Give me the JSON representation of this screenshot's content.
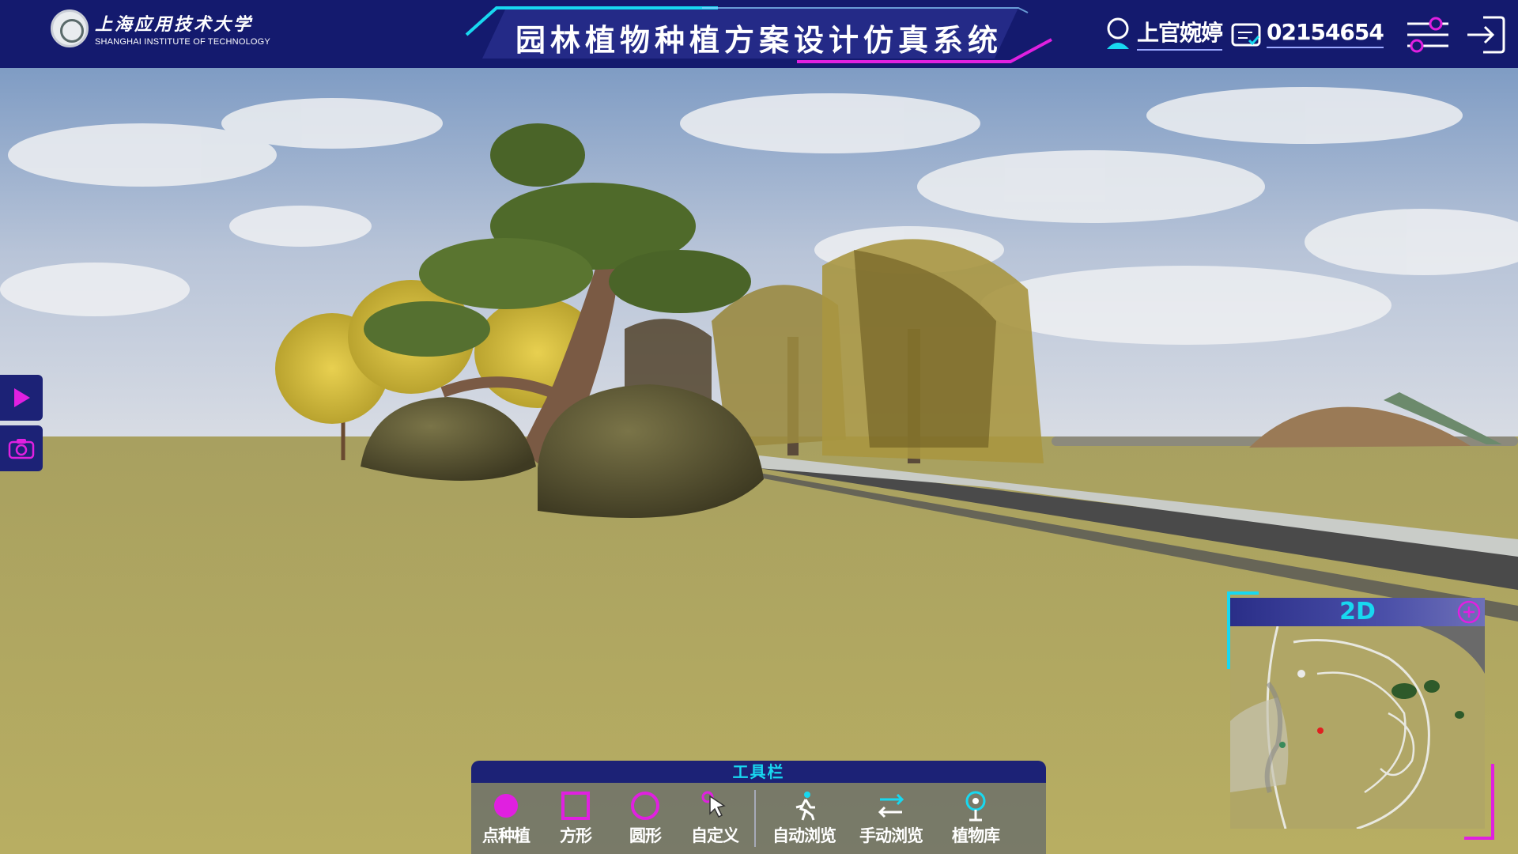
{
  "header": {
    "school_name_cn": "上海应用技术大学",
    "school_name_en": "SHANGHAI INSTITUTE OF TECHNOLOGY",
    "title": "园林植物种植方案设计仿真系统",
    "user_name": "上官婉婷",
    "user_id": "02154654"
  },
  "toolbar": {
    "title": "工具栏",
    "tools": [
      {
        "label": "点种植",
        "icon": "filled-circle-icon"
      },
      {
        "label": "方形",
        "icon": "square-outline-icon"
      },
      {
        "label": "圆形",
        "icon": "circle-outline-icon"
      },
      {
        "label": "自定义",
        "icon": "cursor-custom-icon"
      },
      {
        "label": "自动浏览",
        "icon": "walking-person-icon"
      },
      {
        "label": "手动浏览",
        "icon": "swap-arrows-icon"
      },
      {
        "label": "植物库",
        "icon": "plant-library-icon"
      }
    ]
  },
  "minimap": {
    "mode_label": "2D"
  },
  "colors": {
    "header_bg": "#141a6e",
    "accent_magenta": "#e020e0",
    "accent_cyan": "#18d8f0"
  }
}
